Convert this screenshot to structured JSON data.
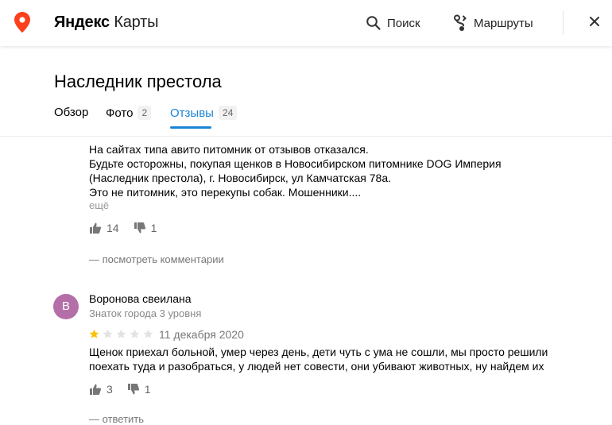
{
  "header": {
    "brand_bold": "Яндекс",
    "brand_light": "Карты",
    "search_label": "Поиск",
    "routes_label": "Маршруты",
    "icons": {
      "logo": "map-pin-icon",
      "search": "search-icon",
      "routes": "route-icon",
      "close": "close-icon"
    },
    "accent_color": "#fc3f1d"
  },
  "org": {
    "title": "Наследник престола"
  },
  "tabs": [
    {
      "label": "Обзор",
      "count": ""
    },
    {
      "label": "Фото",
      "count": "2"
    },
    {
      "label": "Отзывы",
      "count": "24",
      "active": true
    }
  ],
  "tab_active_color": "#1a85d6",
  "reviews": [
    {
      "text_lines": [
        "На сайтах типа авито питомник от отзывов отказался.",
        "Будьте осторожны, покупая щенков в Новосибирском питомнике DOG Империя",
        "(Наследник престола), г. Новосибирск, ул Камчатская 78а.",
        "Это не питомник, это перекупы собак. Мошенники...."
      ],
      "more_label": "ещё",
      "likes": "14",
      "dislikes": "1",
      "comments_label": "— посмотреть комментарии"
    },
    {
      "author": "Воронова свеилана",
      "author_initial": "В",
      "author_level": "Знаток города 3 уровня",
      "rating": 1,
      "rating_max": 5,
      "date": "11 декабря 2020",
      "text_lines": [
        "Щенок приехал больной, умер через день, дети чуть с ума не сошли, мы просто решили",
        "поехать туда и разобраться, у людей нет совести, они убивают животных, ну найдем их"
      ],
      "likes": "3",
      "dislikes": "1",
      "comments_label": "— ответить",
      "avatar_color": "#b56fa8"
    }
  ],
  "star_colors": {
    "filled": "#fcc000",
    "empty": "#e2e2e2"
  }
}
